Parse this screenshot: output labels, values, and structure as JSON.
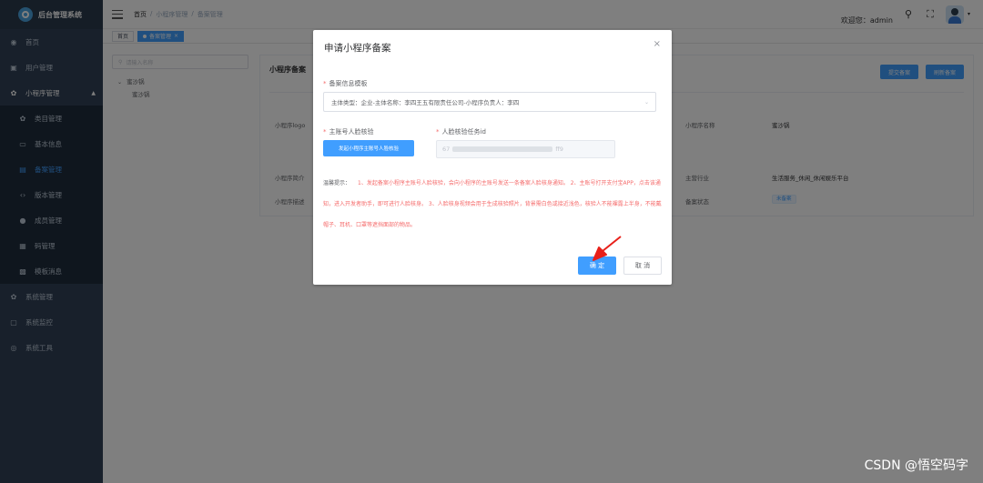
{
  "sidebar": {
    "logo_text": "后台管理系统",
    "items": [
      {
        "label": "首页",
        "icon": "dashboard-icon"
      },
      {
        "label": "用户管理",
        "icon": "user-icon"
      },
      {
        "label": "小程序管理",
        "icon": "miniprogram-icon"
      }
    ],
    "sub_items": [
      {
        "label": "类目管理",
        "icon": "category-icon"
      },
      {
        "label": "基本信息",
        "icon": "info-icon"
      },
      {
        "label": "备案管理",
        "icon": "record-icon",
        "active": true
      },
      {
        "label": "版本管理",
        "icon": "code-icon"
      },
      {
        "label": "成员管理",
        "icon": "member-icon"
      },
      {
        "label": "码管理",
        "icon": "qrcode-icon"
      },
      {
        "label": "模板消息",
        "icon": "template-icon"
      }
    ],
    "bottom_items": [
      {
        "label": "系统管理",
        "icon": "system-icon"
      },
      {
        "label": "系统监控",
        "icon": "monitor-icon"
      },
      {
        "label": "系统工具",
        "icon": "tool-icon"
      }
    ]
  },
  "navbar": {
    "breadcrumb": [
      "首页",
      "/",
      "小程序管理",
      "/",
      "备案管理"
    ],
    "welcome": "欢迎您：admin"
  },
  "tags": {
    "home": "首页",
    "active": "备案管理"
  },
  "tree": {
    "placeholder": "请输入名称",
    "root": "蜜沙锅",
    "child": "蜜沙锅"
  },
  "card": {
    "title": "小程序备案",
    "btn_submit": "提交备案",
    "btn_refresh": "刷新备案",
    "rows": [
      {
        "label": "小程序logo",
        "value": ""
      },
      {
        "label": "小程序简介",
        "value": ""
      },
      {
        "label": "小程序描述",
        "value": ""
      },
      {
        "label": "小程序名称",
        "value": "蜜沙锅"
      },
      {
        "label": "主营行业",
        "value": "生活服务_休闲_休闲娱乐平台"
      },
      {
        "label": "备案状态",
        "value": "未备案"
      }
    ]
  },
  "dialog": {
    "title": "申请小程序备案",
    "template_label": "备案信息模板",
    "template_value": "主体类型：企业-主体名称：李四王五有限责任公司-小程序负责人：李四",
    "face_label": "主账号人脸核验",
    "face_button": "发起小程序主账号人脸核验",
    "task_label": "人脸核验任务id",
    "task_prefix": "67",
    "task_suffix": "ff9",
    "tips_label": "温馨提示：",
    "tips_text": "1、发起备案小程序主账号人脸核验，会向小程序的主账号发送一条备案人脸核身通知。 2、主账号打开支付宝APP，点击该通知，进入开发者助手，即可进行人脸核身。 3、人脸核身视频会用于生成核验照片，背景需白色或接近浅色，核验人不能裸露上半身，不能戴帽子、耳机、口罩等遮挡面部的物品。",
    "confirm": "确 定",
    "cancel": "取 消"
  },
  "watermark": "CSDN @悟空码字",
  "colors": {
    "primary": "#409eff",
    "sidebar_bg": "#304156",
    "danger": "#f56c6c"
  }
}
